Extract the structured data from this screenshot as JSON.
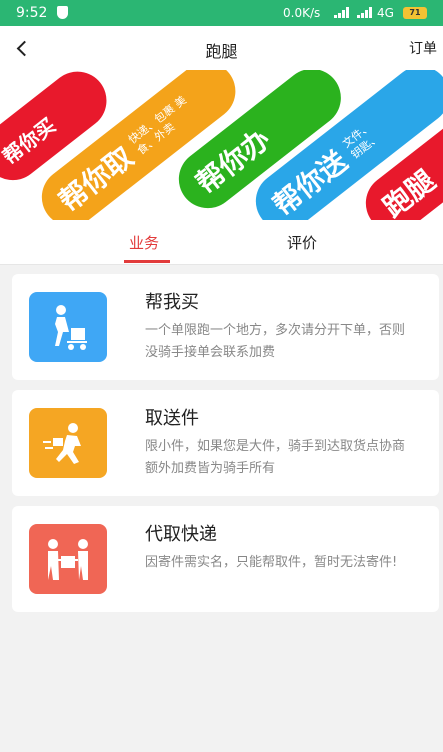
{
  "status_bar": {
    "time": "9:52",
    "network_speed": "0.0K/s",
    "network_type": "4G",
    "battery": "71"
  },
  "header": {
    "title": "跑腿",
    "right_action": "订单"
  },
  "banner": {
    "items": [
      {
        "big": "帮你买",
        "small": "",
        "color": "#e8192c"
      },
      {
        "big": "帮你取",
        "small": "快递、包裹 美食、外卖",
        "color": "#f4a31a"
      },
      {
        "big": "帮你办",
        "small": "",
        "color": "#2bb21e"
      },
      {
        "big": "帮你送",
        "small": "文件、 钥匙、",
        "color": "#2aa6e8"
      },
      {
        "big": "跑腿",
        "small": "",
        "color": "#e8192c"
      }
    ]
  },
  "tabs": [
    {
      "label": "业务"
    },
    {
      "label": "评价"
    }
  ],
  "services": [
    {
      "title": "帮我买",
      "desc": "一个单限跑一个地方，多次请分开下单，否则没骑手接单会联系加费",
      "icon": "delivery-cart-icon",
      "color": "#3fa7f5"
    },
    {
      "title": "取送件",
      "desc": "限小件，如果您是大件，骑手到达取货点协商额外加费皆为骑手所有",
      "icon": "running-courier-icon",
      "color": "#f5a623"
    },
    {
      "title": "代取快递",
      "desc": "因寄件需实名，只能帮取件，暂时无法寄件!",
      "icon": "package-handover-icon",
      "color": "#f06655"
    }
  ]
}
